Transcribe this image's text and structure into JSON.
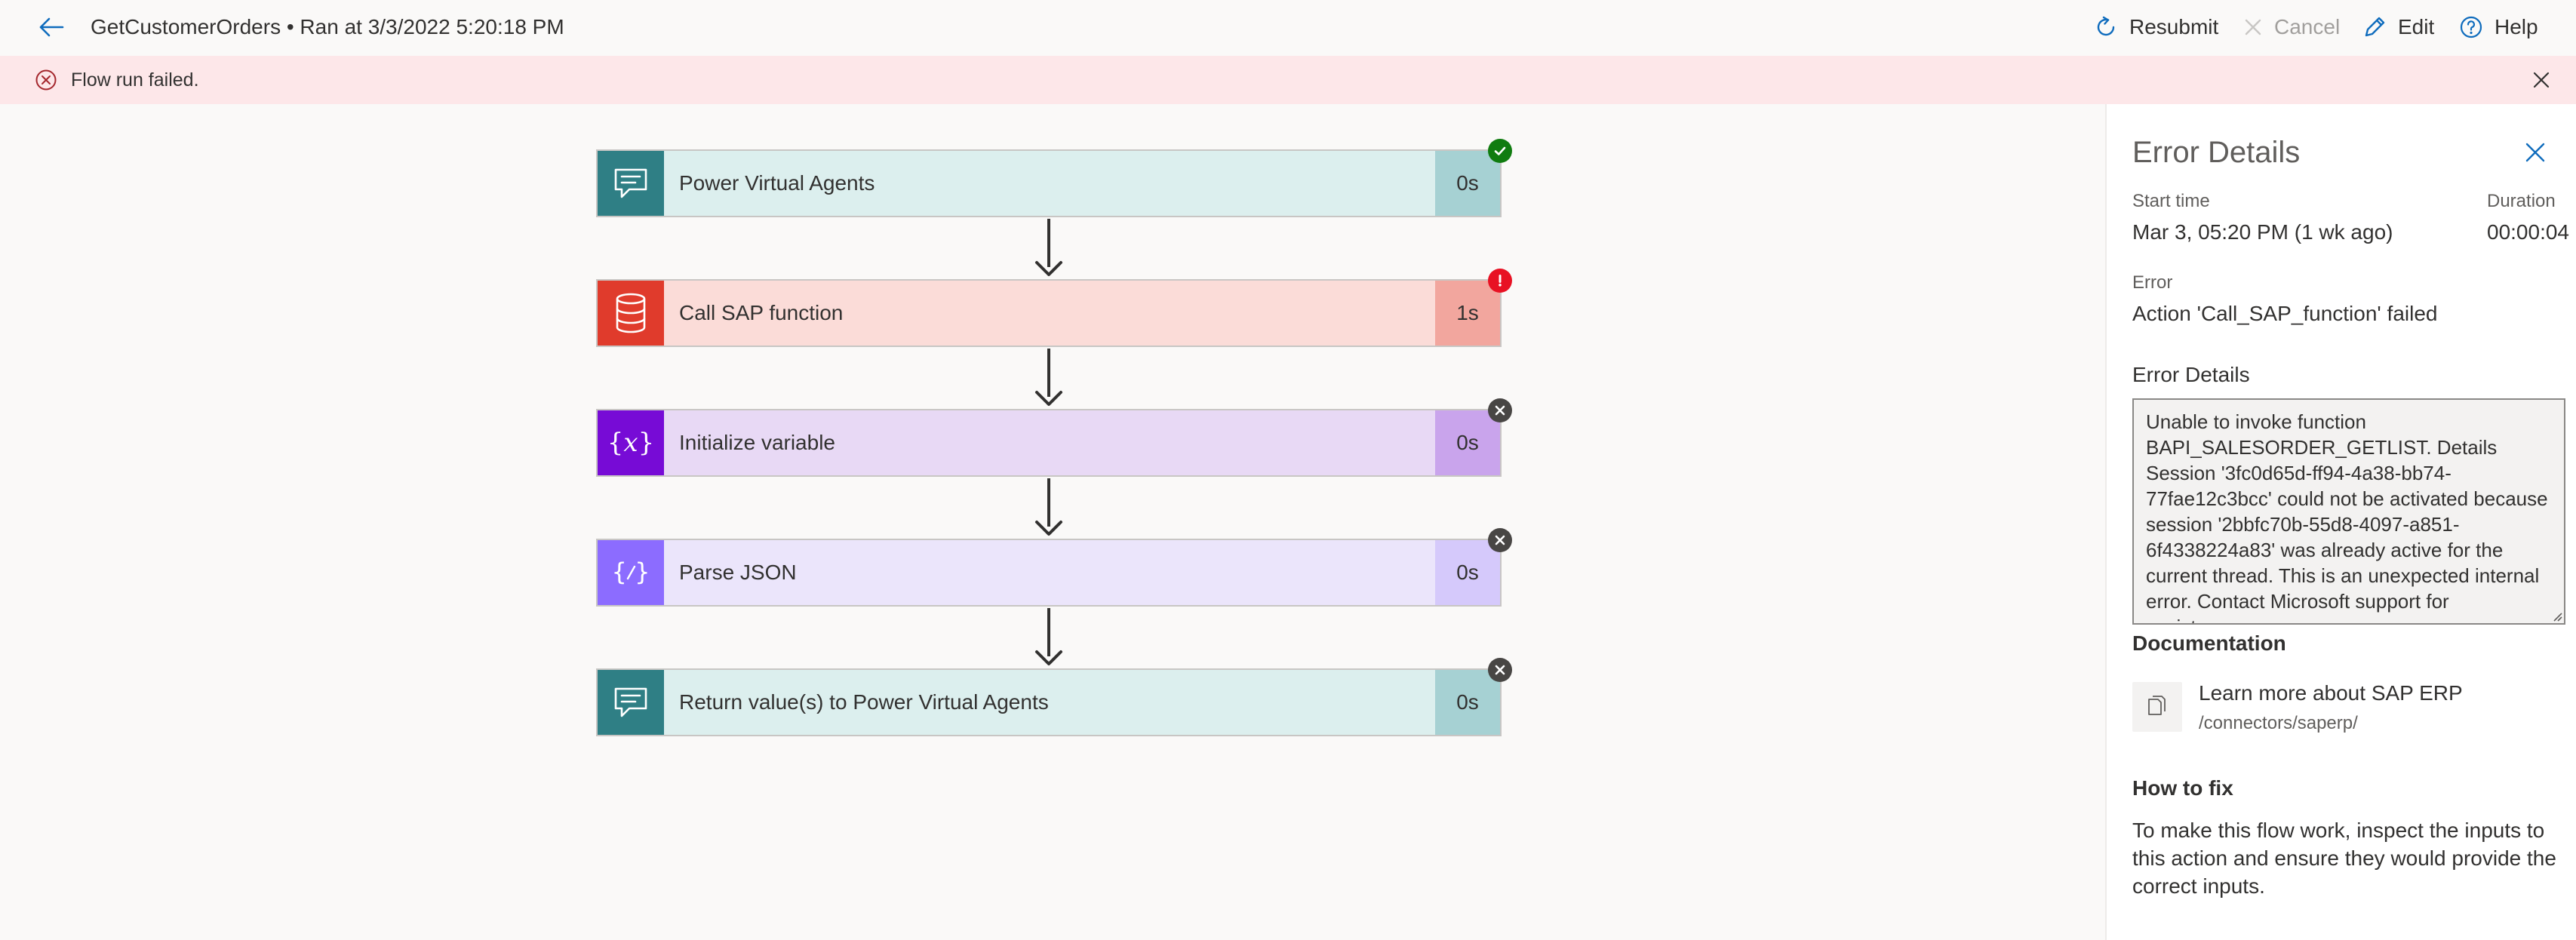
{
  "header": {
    "title": "GetCustomerOrders • Ran at 3/3/2022 5:20:18 PM",
    "commands": {
      "resubmit": "Resubmit",
      "cancel": "Cancel",
      "edit": "Edit",
      "help": "Help"
    }
  },
  "banner": {
    "message": "Flow run failed."
  },
  "flow": {
    "steps": [
      {
        "label": "Power Virtual Agents",
        "duration": "0s",
        "status": "succeeded",
        "icon": "chat-bubble-icon",
        "color": "#2f7f85"
      },
      {
        "label": "Call SAP function",
        "duration": "1s",
        "status": "failed",
        "icon": "database-icon",
        "color": "#d83b01"
      },
      {
        "label": "Initialize variable",
        "duration": "0s",
        "status": "skipped",
        "icon": "variable-icon",
        "color": "#770bd6"
      },
      {
        "label": "Parse JSON",
        "duration": "0s",
        "status": "skipped",
        "icon": "json-icon",
        "color": "#8c6cff"
      },
      {
        "label": "Return value(s) to Power Virtual Agents",
        "duration": "0s",
        "status": "skipped",
        "icon": "chat-bubble-icon",
        "color": "#2f7f85"
      }
    ]
  },
  "panel": {
    "title": "Error Details",
    "start_time_label": "Start time",
    "start_time": "Mar 3, 05:20 PM (1 wk ago)",
    "duration_label": "Duration",
    "duration": "00:00:04",
    "error_label": "Error",
    "error": "Action 'Call_SAP_function' failed",
    "details_label": "Error Details",
    "details": "Unable to invoke function BAPI_SALESORDER_GETLIST. Details Session '3fc0d65d-ff94-4a38-bb74-77fae12c3bcc' could not be activated because session '2bbfc70b-55d8-4097-a851-6f4338224a83' was already active for the current thread. This is an unexpected internal error. Contact Microsoft support for assistance..",
    "documentation_label": "Documentation",
    "doc_link": "Learn more about SAP ERP",
    "doc_path": "/connectors/saperp/",
    "how_to_fix_label": "How to fix",
    "how_to_fix": "To make this flow work, inspect the inputs to this action and ensure they would provide the correct inputs."
  }
}
